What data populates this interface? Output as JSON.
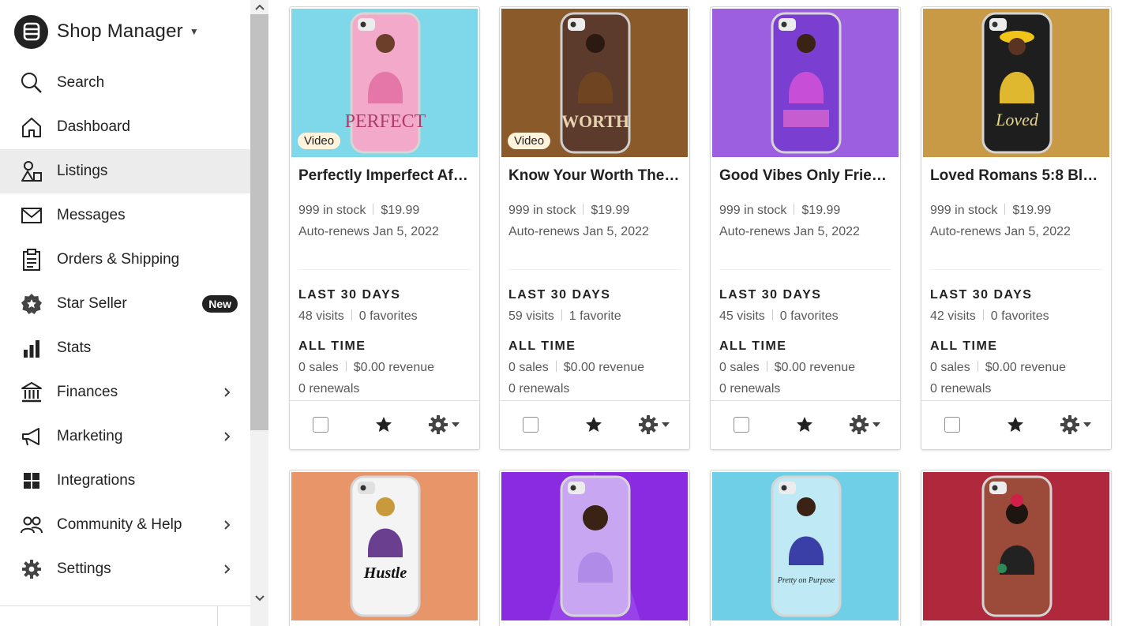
{
  "app": {
    "title": "Shop Manager"
  },
  "nav": {
    "search": "Search",
    "dashboard": "Dashboard",
    "listings": "Listings",
    "messages": "Messages",
    "orders": "Orders & Shipping",
    "star_seller": "Star Seller",
    "star_seller_badge": "New",
    "stats": "Stats",
    "finances": "Finances",
    "marketing": "Marketing",
    "integrations": "Integrations",
    "community": "Community & Help",
    "settings": "Settings",
    "active_item": "Listings"
  },
  "labels": {
    "last_30_days": "LAST 30 DAYS",
    "all_time": "ALL TIME",
    "video": "Video"
  },
  "colors": {
    "accent_dark": "#222222",
    "active_bg": "#ececec",
    "video_tag_bg": "#fff3dc"
  },
  "listings": [
    {
      "title": "Perfectly Imperfect Afr…",
      "stock": "999 in stock",
      "price": "$19.99",
      "renews": "Auto-renews Jan 5, 2022",
      "visits": "48 visits",
      "favorites": "0 favorites",
      "sales": "0 sales",
      "revenue": "$0.00 revenue",
      "renewals": "0 renewals",
      "has_video": true,
      "bg_color": "#7fd7ea",
      "case_text": "PERFECT"
    },
    {
      "title": "Know Your Worth Then…",
      "stock": "999 in stock",
      "price": "$19.99",
      "renews": "Auto-renews Jan 5, 2022",
      "visits": "59 visits",
      "favorites": "1 favorite",
      "sales": "0 sales",
      "revenue": "$0.00 revenue",
      "renewals": "0 renewals",
      "has_video": true,
      "bg_color": "#8a5a2b",
      "case_text": "WORTH"
    },
    {
      "title": "Good Vibes Only Frien…",
      "stock": "999 in stock",
      "price": "$19.99",
      "renews": "Auto-renews Jan 5, 2022",
      "visits": "45 visits",
      "favorites": "0 favorites",
      "sales": "0 sales",
      "revenue": "$0.00 revenue",
      "renewals": "0 renewals",
      "has_video": false,
      "bg_color": "#9c5fe0",
      "case_text": ""
    },
    {
      "title": "Loved Romans 5:8 Bla…",
      "stock": "999 in stock",
      "price": "$19.99",
      "renews": "Auto-renews Jan 5, 2022",
      "visits": "42 visits",
      "favorites": "0 favorites",
      "sales": "0 sales",
      "revenue": "$0.00 revenue",
      "renewals": "0 renewals",
      "has_video": false,
      "bg_color": "#c99a45",
      "case_text": "Loved"
    },
    {
      "bg_color": "#e8956a",
      "case_text": "Hustle"
    },
    {
      "bg_color": "#8a2be2",
      "case_text": ""
    },
    {
      "bg_color": "#6fcfe6",
      "case_text": "Pretty on Purpose"
    },
    {
      "bg_color": "#b0283b",
      "case_text": ""
    }
  ]
}
